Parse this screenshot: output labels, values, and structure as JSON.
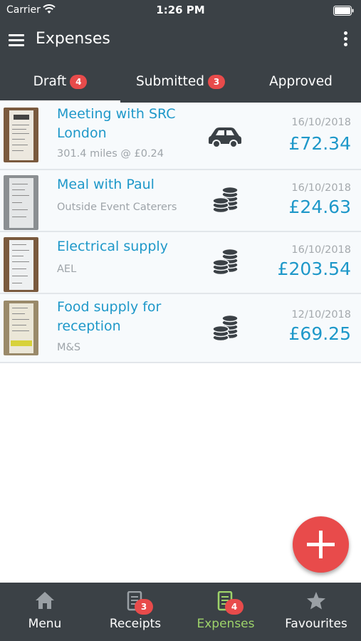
{
  "status_bar": {
    "carrier": "Carrier",
    "time": "1:26 PM"
  },
  "app_bar": {
    "title": "Expenses",
    "menu_icon": "hamburger-icon",
    "more_icon": "more-vertical-icon"
  },
  "tabs": [
    {
      "label": "Draft",
      "badge": "4",
      "active": true
    },
    {
      "label": "Submitted",
      "badge": "3",
      "active": false
    },
    {
      "label": "Approved",
      "badge": "",
      "active": false
    }
  ],
  "expenses": [
    {
      "title": "Meeting with SRC London",
      "subtitle": "301.4 miles @ £0.24",
      "date": "16/10/2018",
      "amount": "£72.34",
      "icon": "car-icon"
    },
    {
      "title": "Meal with Paul",
      "subtitle": "Outside Event Caterers",
      "date": "16/10/2018",
      "amount": "£24.63",
      "icon": "coins-icon"
    },
    {
      "title": "Electrical supply",
      "subtitle": "AEL",
      "date": "16/10/2018",
      "amount": "£203.54",
      "icon": "coins-icon"
    },
    {
      "title": "Food supply for reception",
      "subtitle": "M&S",
      "date": "12/10/2018",
      "amount": "£69.25",
      "icon": "coins-icon"
    }
  ],
  "fab": {
    "icon": "plus-icon"
  },
  "bottom_nav": [
    {
      "label": "Menu",
      "icon": "home-icon",
      "badge": ""
    },
    {
      "label": "Receipts",
      "icon": "receipt-icon",
      "badge": "3"
    },
    {
      "label": "Expenses",
      "icon": "expense-doc-icon",
      "badge": "4",
      "active": true
    },
    {
      "label": "Favourites",
      "icon": "star-icon",
      "badge": ""
    }
  ],
  "colors": {
    "bar": "#3b4146",
    "accent_blue": "#1e98c9",
    "badge_red": "#e84b4b",
    "active_green": "#9ed36a"
  }
}
